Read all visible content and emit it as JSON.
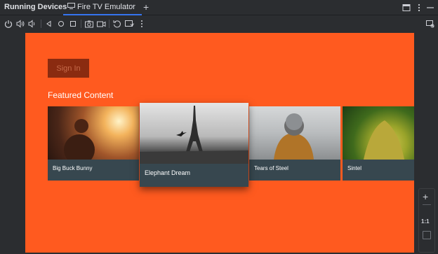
{
  "header": {
    "title": "Running Devices",
    "tab_label": "Fire TV Emulator",
    "tab_close": "×",
    "new_tab": "+"
  },
  "toolbar": {
    "icons": [
      "power-icon",
      "volume-up-icon",
      "volume-down-icon",
      "back-icon",
      "home-icon",
      "overview-icon",
      "screenshot-icon",
      "screen-record-icon",
      "rotate-icon",
      "snapshots-icon",
      "more-icon"
    ],
    "right_icon": "device-mirror-icon"
  },
  "window_controls": [
    "layout-icon",
    "options-icon",
    "minimize-icon"
  ],
  "app": {
    "signin_label": "Sign In",
    "section_title": "Featured Content",
    "cards": [
      {
        "title": "Big Buck Bunny"
      },
      {
        "title": "Elephant Dream"
      },
      {
        "title": "Tears of Steel"
      },
      {
        "title": "Sintel"
      }
    ],
    "colors": {
      "background": "#ff5a1f",
      "card": "#37474f",
      "signin": "#8a2b10"
    }
  },
  "zoom_panel": {
    "plus": "+",
    "ratio": "1:1"
  }
}
